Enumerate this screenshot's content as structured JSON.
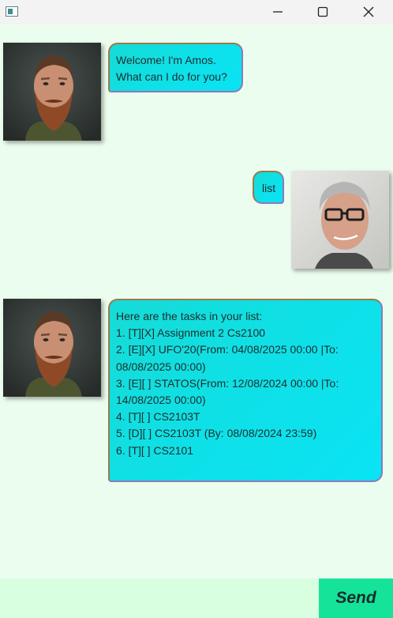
{
  "window": {
    "icons": {
      "app": "app-window-icon",
      "minimize": "minimize-icon",
      "maximize": "maximize-icon",
      "close": "close-icon"
    }
  },
  "chat": {
    "messages": [
      {
        "sender": "bot",
        "avatar": "bearded-man-avatar",
        "text": "Welcome! I'm Amos.\nWhat can I do for you?"
      },
      {
        "sender": "user",
        "avatar": "smiling-man-glasses-avatar",
        "text": "list"
      },
      {
        "sender": "bot",
        "avatar": "bearded-man-avatar",
        "text": "Here are the tasks in your list:\n1. [T][X] Assignment 2 Cs2100\n2. [E][X] UFO'20(From: 04/08/2025 00:00 |To: 08/08/2025 00:00)\n3. [E][ ] STATOS(From: 12/08/2024 00:00 |To: 14/08/2025 00:00)\n4. [T][ ] CS2103T\n5. [D][ ] CS2103T (By: 08/08/2024 23:59)\n6. [T][ ] CS2101"
      }
    ]
  },
  "input": {
    "value": ""
  },
  "send_button": {
    "label": "Send"
  },
  "colors": {
    "background": "#ebfdee",
    "bubble": "#0fe0e6",
    "input_bar": "#d7ffe0",
    "send_button": "#16e39a"
  }
}
